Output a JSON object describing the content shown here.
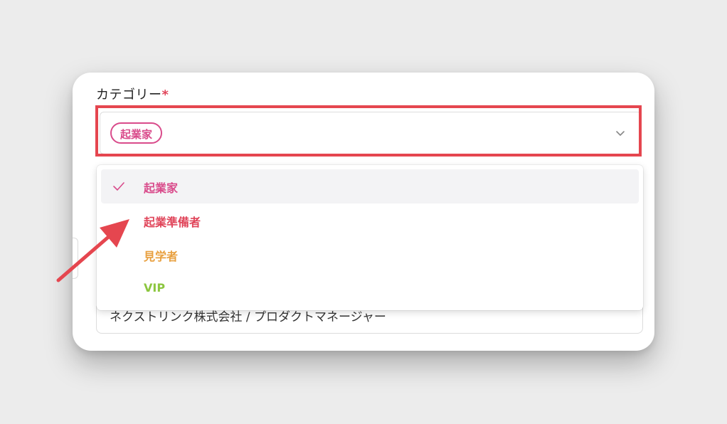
{
  "form": {
    "category_label": "カテゴリー",
    "required_mark": "*",
    "selected_tag": "起業家",
    "chevron_icon": "chevron-down-icon",
    "background_input_value": "ネクストリンク株式会社 / プロダクトマネージャー"
  },
  "dropdown": {
    "check_icon": "check-icon",
    "options": [
      {
        "label": "起業家",
        "color": "#d94b8b",
        "selected": true
      },
      {
        "label": "起業準備者",
        "color": "#e0455a",
        "selected": false
      },
      {
        "label": "見学者",
        "color": "#e8a040",
        "selected": false
      },
      {
        "label": "VIP",
        "color": "#8cc63f",
        "selected": false
      }
    ]
  },
  "annotation": {
    "highlight_color": "#e5464f",
    "arrow_icon": "arrow-icon",
    "arrow_color": "#e5464f"
  }
}
